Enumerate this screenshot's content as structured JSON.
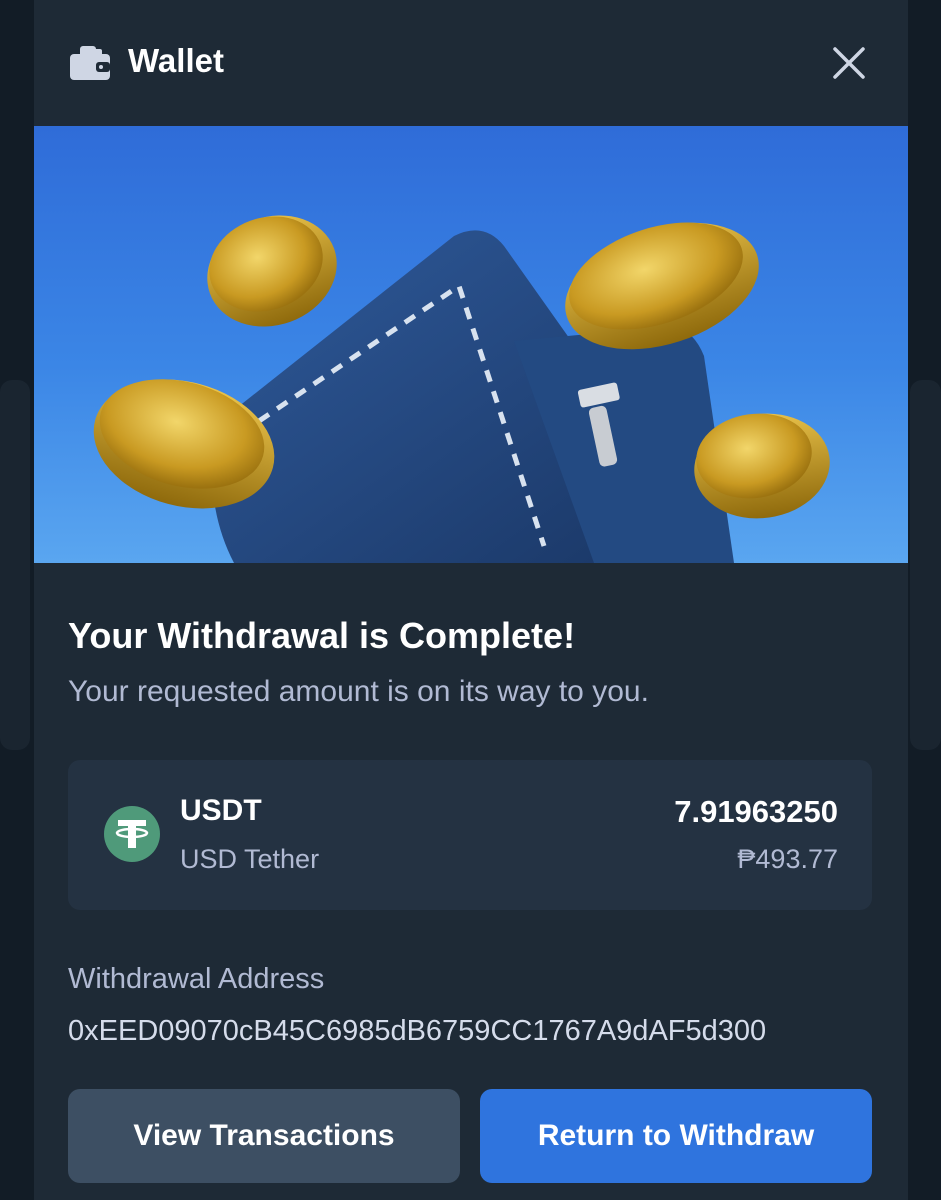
{
  "header": {
    "title": "Wallet",
    "icon": "wallet-icon",
    "close_icon": "close-icon"
  },
  "banner": {
    "illustration": "wallet-with-gold-coins"
  },
  "main": {
    "title": "Your Withdrawal is Complete!",
    "subtitle": "Your requested amount is on its way to you."
  },
  "asset": {
    "symbol": "USDT",
    "name": "USD Tether",
    "amount": "7.91963250",
    "fiat_value": "₱493.77",
    "icon": "tether-icon",
    "icon_color": "#4f9a7a"
  },
  "withdrawal": {
    "address_label": "Withdrawal Address",
    "address": "0xEED09070cB45C6985dB6759CC1767A9dAF5d300"
  },
  "actions": {
    "view_transactions": "View Transactions",
    "return_to_withdraw": "Return to Withdraw"
  },
  "colors": {
    "modal_bg": "#1e2a36",
    "card_bg": "#243242",
    "primary_button": "#2f74de",
    "secondary_button": "#3d4f63",
    "muted_text": "#b1bad3"
  }
}
